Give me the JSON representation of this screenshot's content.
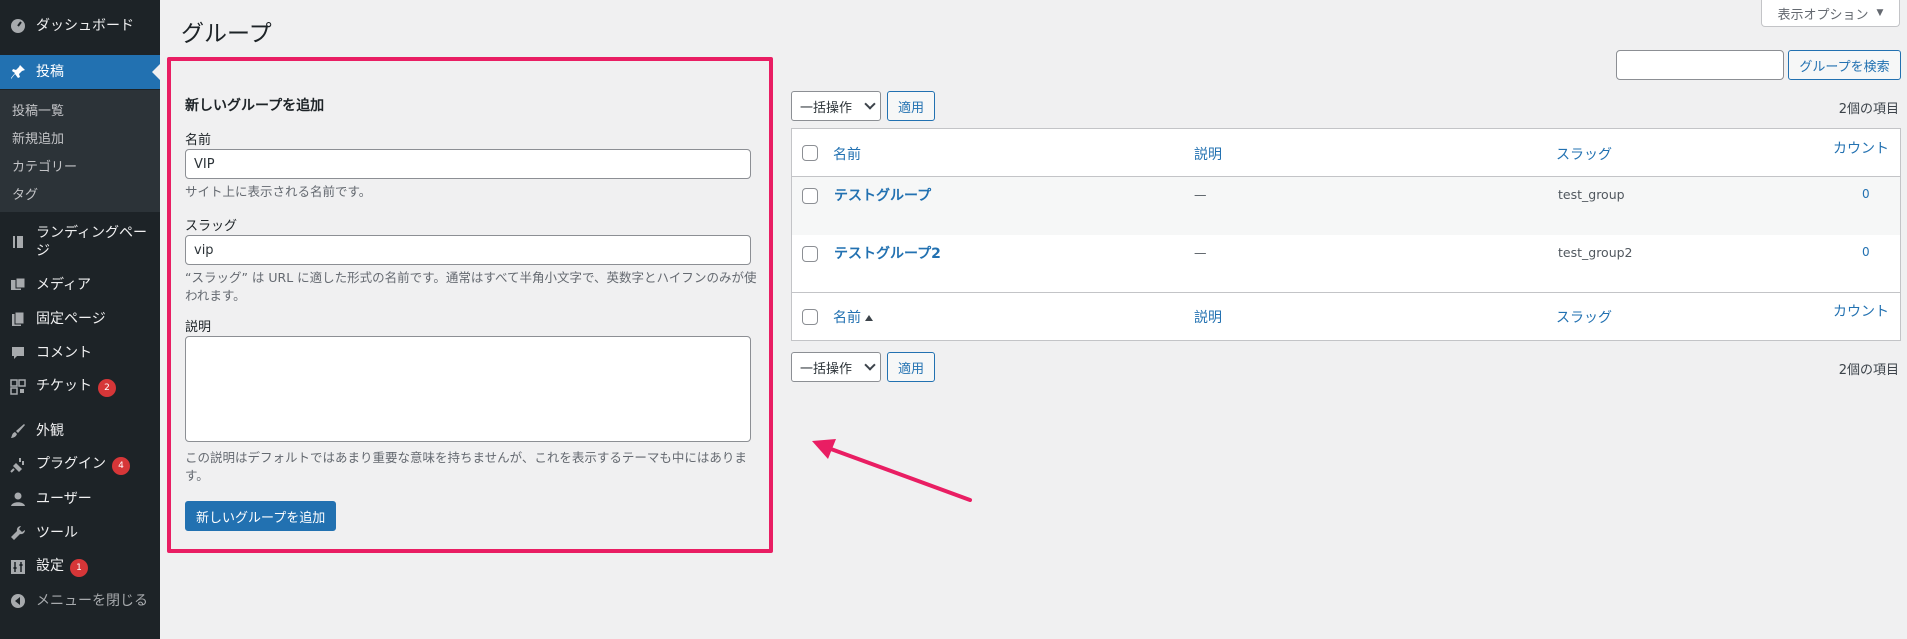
{
  "sidebar": {
    "items": [
      {
        "label": "ダッシュボード",
        "icon": "gauge-icon"
      },
      {
        "label": "投稿",
        "icon": "pin-icon"
      },
      {
        "label": "ランディングページ",
        "icon": "book-icon"
      },
      {
        "label": "メディア",
        "icon": "media-icon"
      },
      {
        "label": "固定ページ",
        "icon": "pages-icon"
      },
      {
        "label": "コメント",
        "icon": "comment-icon"
      },
      {
        "label": "チケット",
        "icon": "grid-icon",
        "badge": "2"
      },
      {
        "label": "外観",
        "icon": "brush-icon"
      },
      {
        "label": "プラグイン",
        "icon": "plugin-icon",
        "badge": "4"
      },
      {
        "label": "ユーザー",
        "icon": "user-icon"
      },
      {
        "label": "ツール",
        "icon": "wrench-icon"
      },
      {
        "label": "設定",
        "icon": "settings-icon",
        "badge": "1"
      },
      {
        "label": "メニューを閉じる",
        "icon": "collapse-icon"
      }
    ],
    "submenu": [
      "投稿一覧",
      "新規追加",
      "カテゴリー",
      "タグ"
    ]
  },
  "header": {
    "title": "グループ",
    "screen_options": "表示オプション"
  },
  "form": {
    "heading": "新しいグループを追加",
    "name_label": "名前",
    "name_value": "VIP",
    "name_help": "サイト上に表示される名前です。",
    "slug_label": "スラッグ",
    "slug_value": "vip",
    "slug_help": "“スラッグ” は URL に適した形式の名前です。通常はすべて半角小文字で、英数字とハイフンのみが使われます。",
    "desc_label": "説明",
    "desc_help": "この説明はデフォルトではあまり重要な意味を持ちませんが、これを表示するテーマも中にはあります。",
    "submit": "新しいグループを追加"
  },
  "search": {
    "button": "グループを検索"
  },
  "bulk": {
    "select": "一括操作",
    "apply": "適用",
    "count": "2個の項目"
  },
  "table": {
    "columns": {
      "name": "名前",
      "description": "説明",
      "slug": "スラッグ",
      "count": "カウント"
    },
    "rows": [
      {
        "name": "テストグループ",
        "description": "—",
        "slug": "test_group",
        "count": "0"
      },
      {
        "name": "テストグループ2",
        "description": "—",
        "slug": "test_group2",
        "count": "0"
      }
    ]
  },
  "colors": {
    "accent": "#2271b1",
    "highlight": "#e91e63",
    "sidebar": "#1d2327",
    "badge": "#d63638"
  }
}
